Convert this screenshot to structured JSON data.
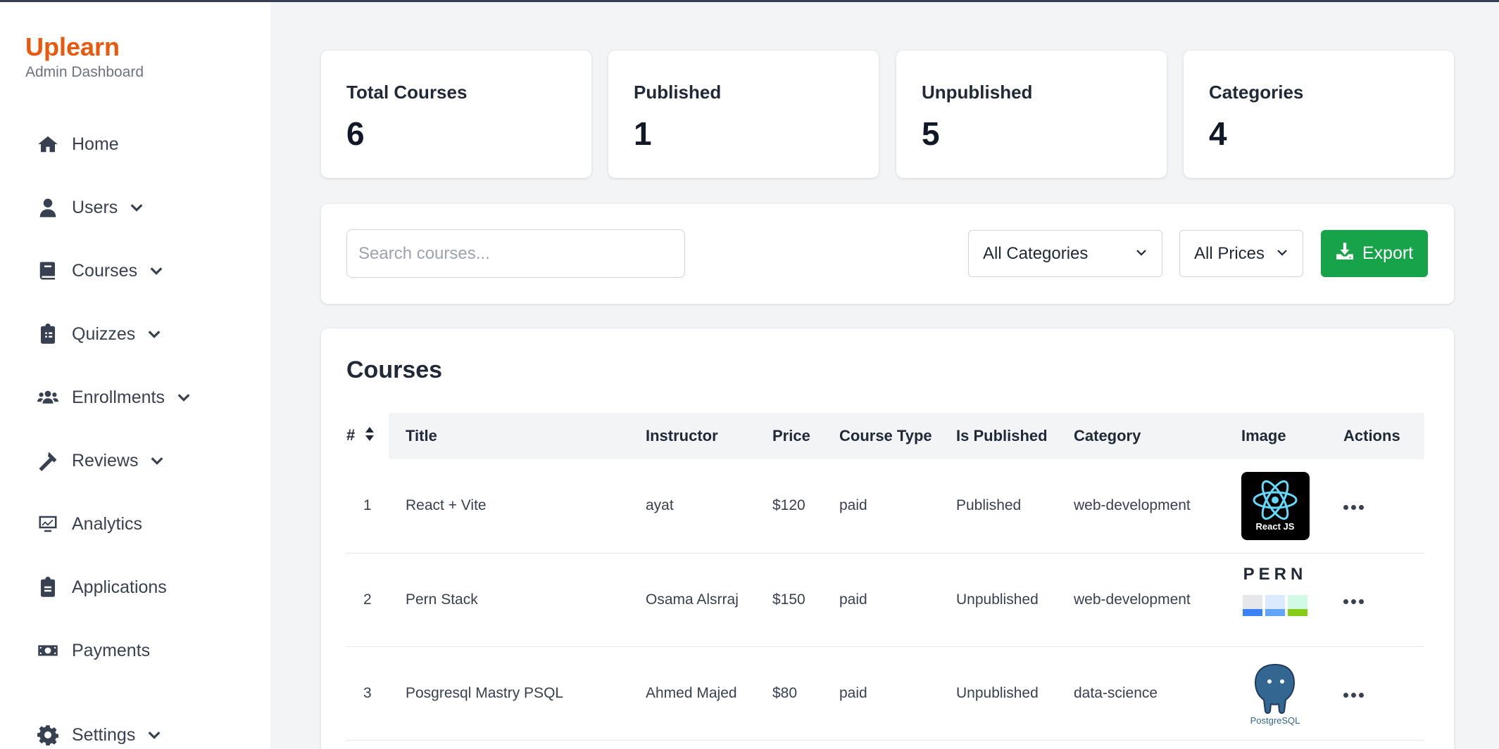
{
  "brand": {
    "name": "Uplearn",
    "subtitle": "Admin Dashboard"
  },
  "sidebar": {
    "items": [
      {
        "label": "Home",
        "icon": "home-icon",
        "has_chevron": false
      },
      {
        "label": "Users",
        "icon": "user-icon",
        "has_chevron": true
      },
      {
        "label": "Courses",
        "icon": "book-icon",
        "has_chevron": true
      },
      {
        "label": "Quizzes",
        "icon": "clipboard-list-icon",
        "has_chevron": true
      },
      {
        "label": "Enrollments",
        "icon": "users-icon",
        "has_chevron": true
      },
      {
        "label": "Reviews",
        "icon": "hammer-icon",
        "has_chevron": true
      },
      {
        "label": "Analytics",
        "icon": "chart-monitor-icon",
        "has_chevron": false
      },
      {
        "label": "Applications",
        "icon": "clipboard-icon",
        "has_chevron": false
      },
      {
        "label": "Payments",
        "icon": "money-bill-icon",
        "has_chevron": false
      },
      {
        "label": "Settings",
        "icon": "gear-icon",
        "has_chevron": true
      }
    ]
  },
  "stats": [
    {
      "label": "Total Courses",
      "value": "6"
    },
    {
      "label": "Published",
      "value": "1"
    },
    {
      "label": "Unpublished",
      "value": "5"
    },
    {
      "label": "Categories",
      "value": "4"
    }
  ],
  "filters": {
    "search_placeholder": "Search courses...",
    "category_selected": "All Categories",
    "price_selected": "All Prices",
    "export_label": "Export"
  },
  "courses": {
    "title": "Courses",
    "columns": [
      "#",
      "Title",
      "Instructor",
      "Price",
      "Course Type",
      "Is Published",
      "Category",
      "Image",
      "Actions"
    ],
    "rows": [
      {
        "num": "1",
        "title": "React + Vite",
        "instructor": "ayat",
        "price": "$120",
        "type": "paid",
        "published": "Published",
        "category": "web-development",
        "image_text": "React JS"
      },
      {
        "num": "2",
        "title": "Pern Stack",
        "instructor": "Osama Alsrraj",
        "price": "$150",
        "type": "paid",
        "published": "Unpublished",
        "category": "web-development",
        "image_text": "PERN"
      },
      {
        "num": "3",
        "title": "Posgresql Mastry PSQL",
        "instructor": "Ahmed Majed",
        "price": "$80",
        "type": "paid",
        "published": "Unpublished",
        "category": "data-science",
        "image_text": "PostgreSQL"
      }
    ]
  },
  "colors": {
    "brand": "#ea580c",
    "export": "#16a34a",
    "text": "#374151"
  }
}
